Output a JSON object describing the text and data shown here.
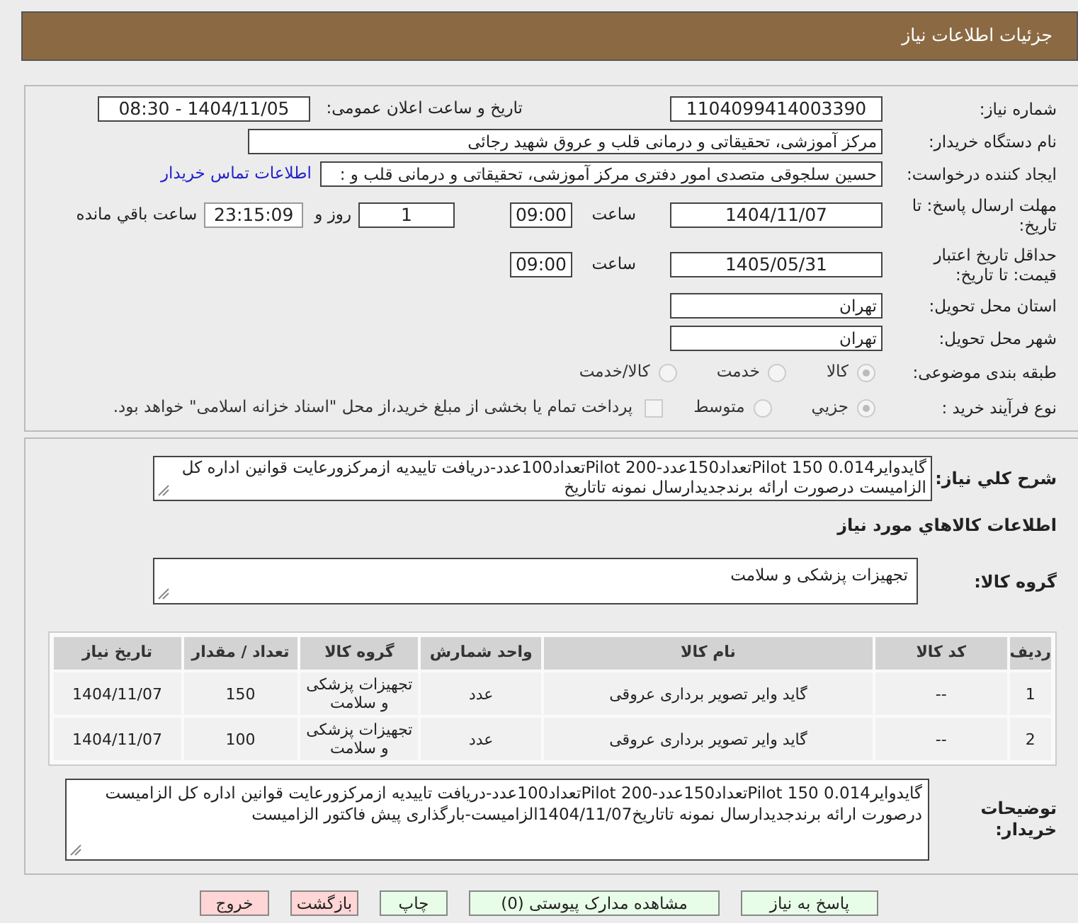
{
  "header": {
    "title": "جزئیات اطلاعات نیاز"
  },
  "need_number": {
    "label": "شماره نیاز:",
    "value": "1104099414003390"
  },
  "announce": {
    "label": "تاریخ و ساعت اعلان عمومی:",
    "value": "1404/11/05 - 08:30"
  },
  "buyer": {
    "label": "نام دستگاه خریدار:",
    "value": "مرکز آموزشی، تحقیقاتی و درمانی قلب و عروق شهید رجائی"
  },
  "creator": {
    "label": "ایجاد کننده درخواست:",
    "value": "حسین سلجوقی متصدی امور دفتری مرکز آموزشی، تحقیقاتی و درمانی قلب و :",
    "link": "اطلاعات تماس خریدار"
  },
  "deadline": {
    "label": "مهلت ارسال پاسخ: تا تاریخ:",
    "date": "1404/11/07",
    "time_label": "ساعت",
    "time": "09:00",
    "days": "1",
    "days_label": "روز و",
    "remaining": "23:15:09",
    "remaining_label": "ساعت باقي مانده"
  },
  "validity": {
    "label": "حداقل تاریخ اعتبار قیمت: تا تاریخ:",
    "date": "1405/05/31",
    "time_label": "ساعت",
    "time": "09:00"
  },
  "province": {
    "label": "استان محل تحویل:",
    "value": "تهران"
  },
  "city": {
    "label": "شهر محل تحویل:",
    "value": "تهران"
  },
  "category": {
    "label": "طبقه بندی موضوعی:",
    "options": [
      {
        "label": "کالا",
        "selected": true
      },
      {
        "label": "خدمت",
        "selected": false
      },
      {
        "label": "کالا/خدمت",
        "selected": false
      }
    ]
  },
  "process": {
    "label": "نوع فرآیند خرید :",
    "options": [
      {
        "label": "جزیي",
        "selected": true
      },
      {
        "label": "متوسط",
        "selected": false
      }
    ],
    "treasury": {
      "label": "پرداخت تمام یا بخشی از مبلغ خرید،از محل \"اسناد خزانه اسلامی\" خواهد بود.",
      "checked": false
    }
  },
  "description": {
    "label": "شرح کلي نیاز:",
    "value": "گایدوایر0.014 Pilot 150تعداد150عدد-Pilot 200تعداد100عدد-دریافت تاییدیه ازمرکزورعایت قوانین اداره کل الزامیست درصورت ارائه برندجدیدارسال نمونه تاتاریخ"
  },
  "goods_heading": "اطلاعات کالاهاي مورد نیاز",
  "goods_group": {
    "label": "گروه کالا:",
    "value": "تجهیزات پزشکی و سلامت"
  },
  "table": {
    "columns": [
      "ردیف",
      "کد کالا",
      "نام کالا",
      "واحد شمارش",
      "گروه کالا",
      "تعداد / مقدار",
      "تاریخ نیاز"
    ],
    "rows": [
      [
        "1",
        "--",
        "گاید وایر تصویر برداری عروقی",
        "عدد",
        "تجهیزات پزشکی و سلامت",
        "150",
        "1404/11/07"
      ],
      [
        "2",
        "--",
        "گاید وایر تصویر برداری عروقی",
        "عدد",
        "تجهیزات پزشکی و سلامت",
        "100",
        "1404/11/07"
      ]
    ]
  },
  "buyer_notes": {
    "label": "توضیحات خریدار:",
    "value": "گایدوایر0.014 Pilot 150تعداد150عدد-Pilot 200تعداد100عدد-دریافت تاییدیه ازمرکزورعایت قوانین اداره کل الزامیست درصورت ارائه برندجدیدارسال نمونه تاتاریخ1404/11/07الزامیست-بارگذاری پیش فاکتور الزامیست"
  },
  "buttons": [
    {
      "label": "پاسخ به نیاز",
      "kind": "primary"
    },
    {
      "label": "مشاهده مدارک پیوستی (0)",
      "kind": "primary"
    },
    {
      "label": "چاپ",
      "kind": "primary"
    },
    {
      "label": "بازگشت",
      "kind": "danger"
    },
    {
      "label": "خروج",
      "kind": "danger"
    }
  ]
}
